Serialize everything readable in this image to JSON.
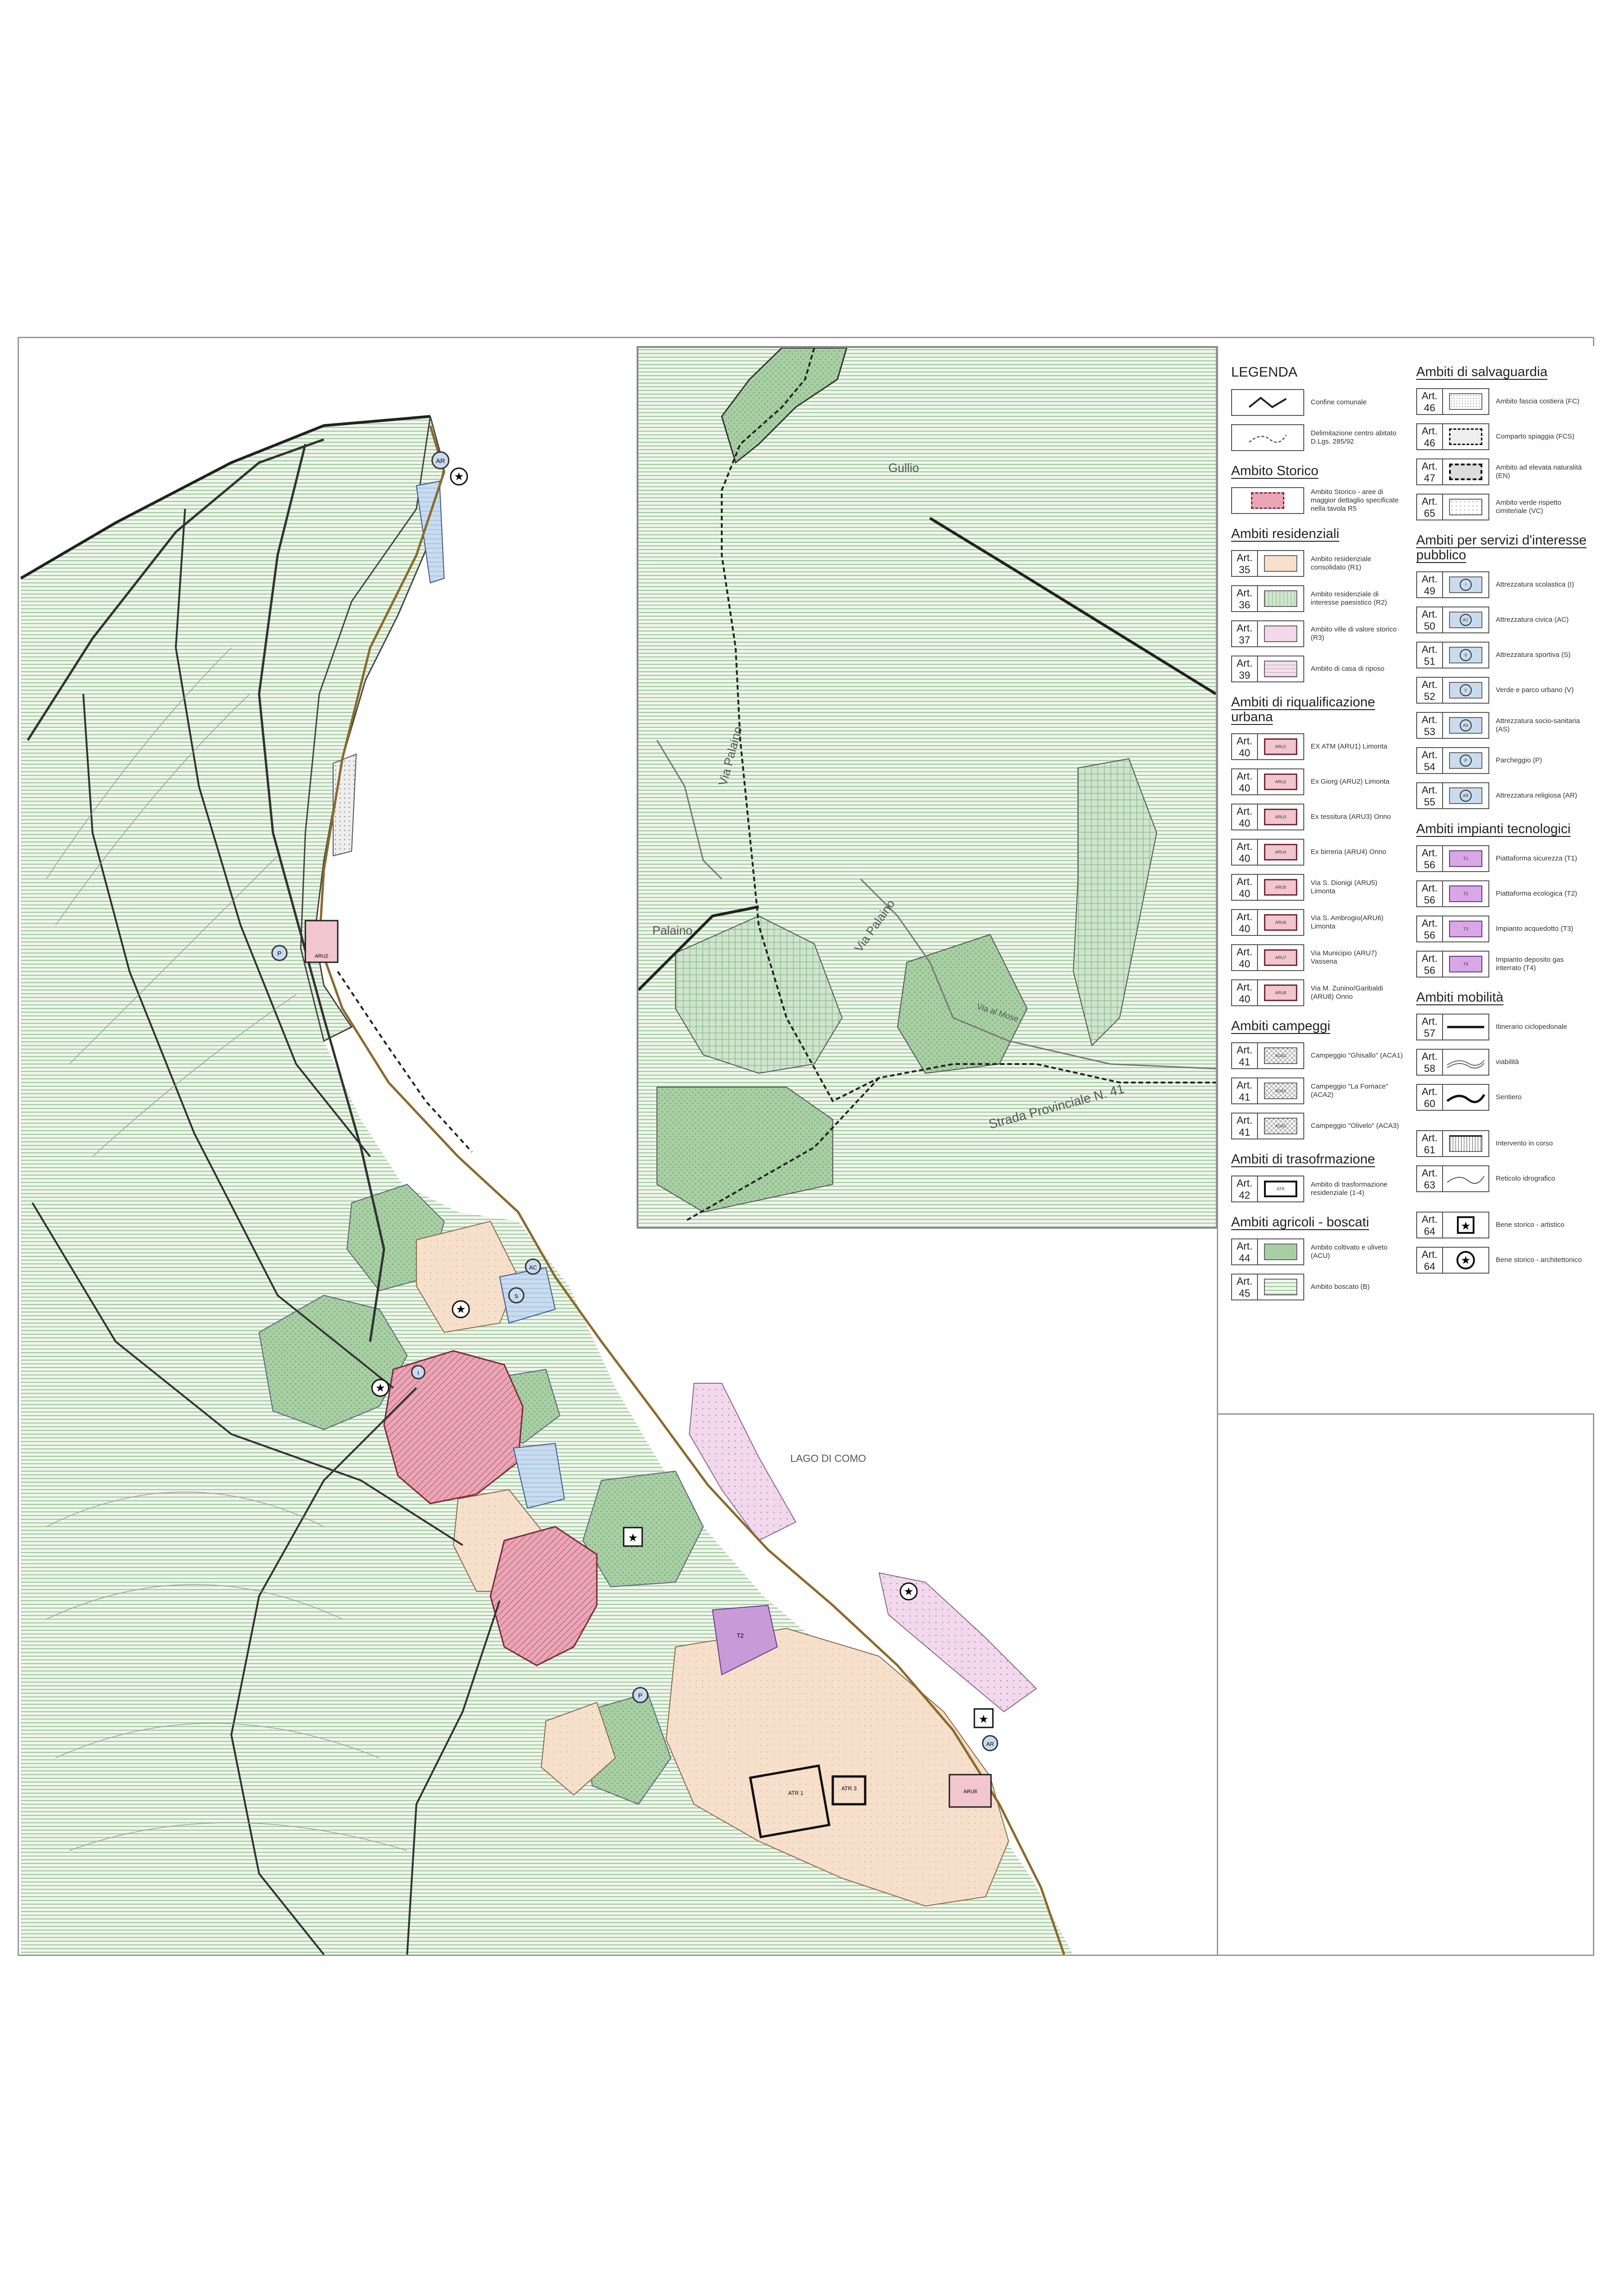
{
  "map": {
    "lake_label": "LAGO DI COMO",
    "inset_labels": {
      "place_1": "Gullio",
      "place_2": "Palaino",
      "road_1": "Via Palaino",
      "road_2": "Via Palaino",
      "road_3": "Via al Mose",
      "road_4": "Strada Provinciale N. 41"
    },
    "colors": {
      "agricultural_green": "#d3e6cf",
      "wood_green": "#8fbf8f",
      "historic_pink": "#e8a3b3",
      "residential_beige": "#f4dcc8",
      "ar_pink": "#ecd3e6",
      "villa_green": "#bfe0c0",
      "service_blue": "#c9ddef",
      "tech_purple": "#c99ad8",
      "road_brown": "#8a6a2a"
    }
  },
  "legend": {
    "title": "LEGENDA",
    "left_sections": [
      {
        "heading": "",
        "items": [
          {
            "art": "",
            "label": "Confine comunale",
            "symbol": "border-line"
          },
          {
            "art": "",
            "label": "Delimitazione centro abitato D.Lgs. 285/92",
            "symbol": "dashed-line"
          }
        ]
      },
      {
        "heading": "Ambito Storico",
        "items": [
          {
            "art": "",
            "label": "Ambito Storico - aree di maggior dettaglio specificate nella tavola R5",
            "symbol": "historic"
          }
        ]
      },
      {
        "heading": "Ambiti residenziali",
        "items": [
          {
            "art": "Art. 35",
            "label": "Ambito residenziale consolidato (R1)",
            "symbol": "r1",
            "code": ""
          },
          {
            "art": "Art. 36",
            "label": "Ambito residenziale di interesse paesistico (R2)",
            "symbol": "r2",
            "code": ""
          },
          {
            "art": "Art. 37",
            "label": "Ambito ville di valore storico (R3)",
            "symbol": "r3",
            "code": ""
          },
          {
            "art": "Art. 39",
            "label": "Ambito di casa di riposo",
            "symbol": "r4",
            "code": ""
          }
        ]
      },
      {
        "heading": "Ambiti di riqualificazione urbana",
        "items": [
          {
            "art": "Art. 40",
            "label": "EX ATM (ARU1) Limonta",
            "symbol": "aru",
            "code": "ARU1"
          },
          {
            "art": "Art. 40",
            "label": "Ex Giorg (ARU2) Limonta",
            "symbol": "aru",
            "code": "ARU2"
          },
          {
            "art": "Art. 40",
            "label": "Ex tessitura (ARU3) Onno",
            "symbol": "aru",
            "code": "ARU3"
          },
          {
            "art": "Art. 40",
            "label": "Ex birreria (ARU4) Onno",
            "symbol": "aru",
            "code": "ARU4"
          },
          {
            "art": "Art. 40",
            "label": "Via S. Dionigi (ARU5) Limonta",
            "symbol": "aru",
            "code": "ARU5"
          },
          {
            "art": "Art. 40",
            "label": "Via S. Ambrogio(ARU6) Limonta",
            "symbol": "aru",
            "code": "ARU6"
          },
          {
            "art": "Art. 40",
            "label": "Via Municipio (ARU7) Vassena",
            "symbol": "aru",
            "code": "ARU7"
          },
          {
            "art": "Art. 40",
            "label": "Via M. Zunino/Garibaldi (ARU8) Onno",
            "symbol": "aru",
            "code": "ARU8"
          }
        ]
      },
      {
        "heading": "Ambiti campeggi",
        "items": [
          {
            "art": "Art. 41",
            "label": "Campeggio \"Ghisallo\" (ACA1)",
            "symbol": "aca",
            "code": "ACA1"
          },
          {
            "art": "Art. 41",
            "label": "Campeggio \"La Fornace\" (ACA2)",
            "symbol": "aca",
            "code": "ACA2"
          },
          {
            "art": "Art. 41",
            "label": "Campeggio \"Olivelo\" (ACA3)",
            "symbol": "aca",
            "code": "ACA3"
          }
        ]
      },
      {
        "heading": "Ambiti di trasofrmazione",
        "items": [
          {
            "art": "Art. 42",
            "label": "Ambito di trasformazione residenziale (1-4)",
            "symbol": "atr",
            "code": "ATR"
          }
        ]
      },
      {
        "heading": "Ambiti agricoli - boscati",
        "items": [
          {
            "art": "Art. 44",
            "label": "Ambito coltivato e uliveto (ACU)",
            "symbol": "acu",
            "code": ""
          },
          {
            "art": "Art. 45",
            "label": "Ambito boscato (B)",
            "symbol": "b",
            "code": ""
          }
        ]
      }
    ],
    "right_sections": [
      {
        "heading": "Ambiti di salvaguardia",
        "items": [
          {
            "art": "Art. 46",
            "label": "Ambito fascia costiera (FC)",
            "symbol": "fc"
          },
          {
            "art": "Art. 46",
            "label": "Comparto spiaggia (FCS)",
            "symbol": "fcs"
          },
          {
            "art": "Art. 47",
            "label": "Ambito ad elevata naturalità (EN)",
            "symbol": "en"
          },
          {
            "art": "Art. 65",
            "label": "Ambito verde rispetto cimiteriale (VC)",
            "symbol": "vc"
          }
        ]
      },
      {
        "heading": "Ambiti per servizi d'interesse pubblico",
        "items": [
          {
            "art": "Art. 49",
            "label": "Attrezzatura scolastica (I)",
            "symbol": "srv",
            "code": "I"
          },
          {
            "art": "Art. 50",
            "label": "Attrezzatura civica (AC)",
            "symbol": "srv",
            "code": "AC"
          },
          {
            "art": "Art. 51",
            "label": "Attrezzatura sportiva (S)",
            "symbol": "srv",
            "code": "S"
          },
          {
            "art": "Art. 52",
            "label": "Verde e parco urbano (V)",
            "symbol": "srv",
            "code": "V"
          },
          {
            "art": "Art. 53",
            "label": "Attrezzatura socio-sanitaria (AS)",
            "symbol": "srv",
            "code": "AS"
          },
          {
            "art": "Art. 54",
            "label": "Parcheggio (P)",
            "symbol": "srv",
            "code": "P"
          },
          {
            "art": "Art. 55",
            "label": "Attrezzatura religiosa (AR)",
            "symbol": "srv",
            "code": "AR"
          }
        ]
      },
      {
        "heading": "Ambiti impianti tecnologici",
        "items": [
          {
            "art": "Art. 56",
            "label": "Piattaforma sicurezza (T1)",
            "symbol": "tec",
            "code": "T1"
          },
          {
            "art": "Art. 56",
            "label": "Piattaforma ecologica (T2)",
            "symbol": "tec",
            "code": "T2"
          },
          {
            "art": "Art. 56",
            "label": "Impianto acquedotto (T3)",
            "symbol": "tec",
            "code": "T3"
          },
          {
            "art": "Art. 56",
            "label": "Impianto deposito gas interrato (T4)",
            "symbol": "tec",
            "code": "T4"
          }
        ]
      },
      {
        "heading": "Ambiti mobilità",
        "items": [
          {
            "art": "Art. 57",
            "label": "Itinerario ciclopedonale",
            "symbol": "cycle"
          },
          {
            "art": "Art. 58",
            "label": "viabilità",
            "symbol": "road"
          },
          {
            "art": "Art. 60",
            "label": "Sentiero",
            "symbol": "path"
          }
        ]
      },
      {
        "heading": "",
        "items": [
          {
            "art": "Art. 61",
            "label": "Intervento in corso",
            "symbol": "works"
          },
          {
            "art": "Art. 63",
            "label": "Reticolo idrografico",
            "symbol": "river"
          }
        ]
      },
      {
        "heading": "",
        "items": [
          {
            "art": "Art. 64",
            "label": "Bene storico - artistico",
            "symbol": "star-square"
          },
          {
            "art": "Art. 64",
            "label": "Bene storico - architettonico",
            "symbol": "star-circle"
          }
        ]
      }
    ]
  },
  "map_codes": {
    "ar_1": "AR",
    "ar_2": "AR",
    "ac": "AC",
    "p_1": "P",
    "p_2": "P",
    "s": "S",
    "i": "I",
    "t": "T2",
    "aru_1": "ARU2",
    "aru_2": "ARU8",
    "atr_1": "ATR 1",
    "atr_2": "ATR 3"
  }
}
